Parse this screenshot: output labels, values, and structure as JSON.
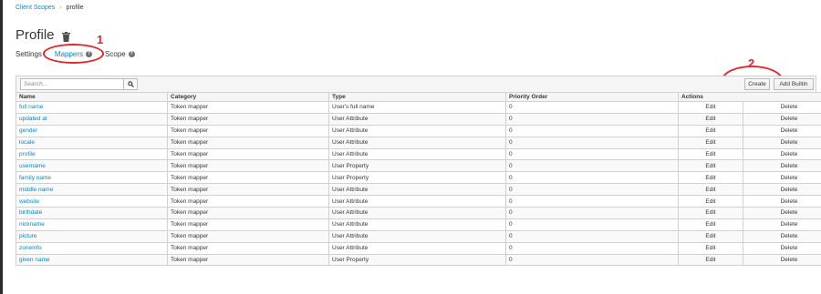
{
  "breadcrumb": {
    "parent": "Client Scopes",
    "separator": "›",
    "current": "profile"
  },
  "page": {
    "title": "Profile"
  },
  "tabs": [
    {
      "label": "Settings",
      "active": false,
      "help": false
    },
    {
      "label": "Mappers",
      "active": true,
      "help": true
    },
    {
      "label": "Scope",
      "active": false,
      "help": true
    }
  ],
  "annotations": {
    "first": "1",
    "second": "2",
    "color": "#e4262c"
  },
  "toolbar": {
    "search_placeholder": "Search...",
    "create_label": "Create",
    "add_builtin_label": "Add Builtin"
  },
  "table": {
    "columns": [
      "Name",
      "Category",
      "Type",
      "Priority Order",
      "Actions"
    ],
    "rows": [
      {
        "name": "full name",
        "category": "Token mapper",
        "type": "User's full name",
        "priority": "0",
        "edit": "Edit",
        "delete": "Delete"
      },
      {
        "name": "updated at",
        "category": "Token mapper",
        "type": "User Attribute",
        "priority": "0",
        "edit": "Edit",
        "delete": "Delete"
      },
      {
        "name": "gender",
        "category": "Token mapper",
        "type": "User Attribute",
        "priority": "0",
        "edit": "Edit",
        "delete": "Delete"
      },
      {
        "name": "locale",
        "category": "Token mapper",
        "type": "User Attribute",
        "priority": "0",
        "edit": "Edit",
        "delete": "Delete"
      },
      {
        "name": "profile",
        "category": "Token mapper",
        "type": "User Attribute",
        "priority": "0",
        "edit": "Edit",
        "delete": "Delete"
      },
      {
        "name": "username",
        "category": "Token mapper",
        "type": "User Property",
        "priority": "0",
        "edit": "Edit",
        "delete": "Delete"
      },
      {
        "name": "family name",
        "category": "Token mapper",
        "type": "User Property",
        "priority": "0",
        "edit": "Edit",
        "delete": "Delete"
      },
      {
        "name": "middle name",
        "category": "Token mapper",
        "type": "User Attribute",
        "priority": "0",
        "edit": "Edit",
        "delete": "Delete"
      },
      {
        "name": "website",
        "category": "Token mapper",
        "type": "User Attribute",
        "priority": "0",
        "edit": "Edit",
        "delete": "Delete"
      },
      {
        "name": "birthdate",
        "category": "Token mapper",
        "type": "User Attribute",
        "priority": "0",
        "edit": "Edit",
        "delete": "Delete"
      },
      {
        "name": "nickname",
        "category": "Token mapper",
        "type": "User Attribute",
        "priority": "0",
        "edit": "Edit",
        "delete": "Delete"
      },
      {
        "name": "picture",
        "category": "Token mapper",
        "type": "User Attribute",
        "priority": "0",
        "edit": "Edit",
        "delete": "Delete"
      },
      {
        "name": "zoneinfo",
        "category": "Token mapper",
        "type": "User Attribute",
        "priority": "0",
        "edit": "Edit",
        "delete": "Delete"
      },
      {
        "name": "given name",
        "category": "Token mapper",
        "type": "User Property",
        "priority": "0",
        "edit": "Edit",
        "delete": "Delete"
      }
    ]
  }
}
